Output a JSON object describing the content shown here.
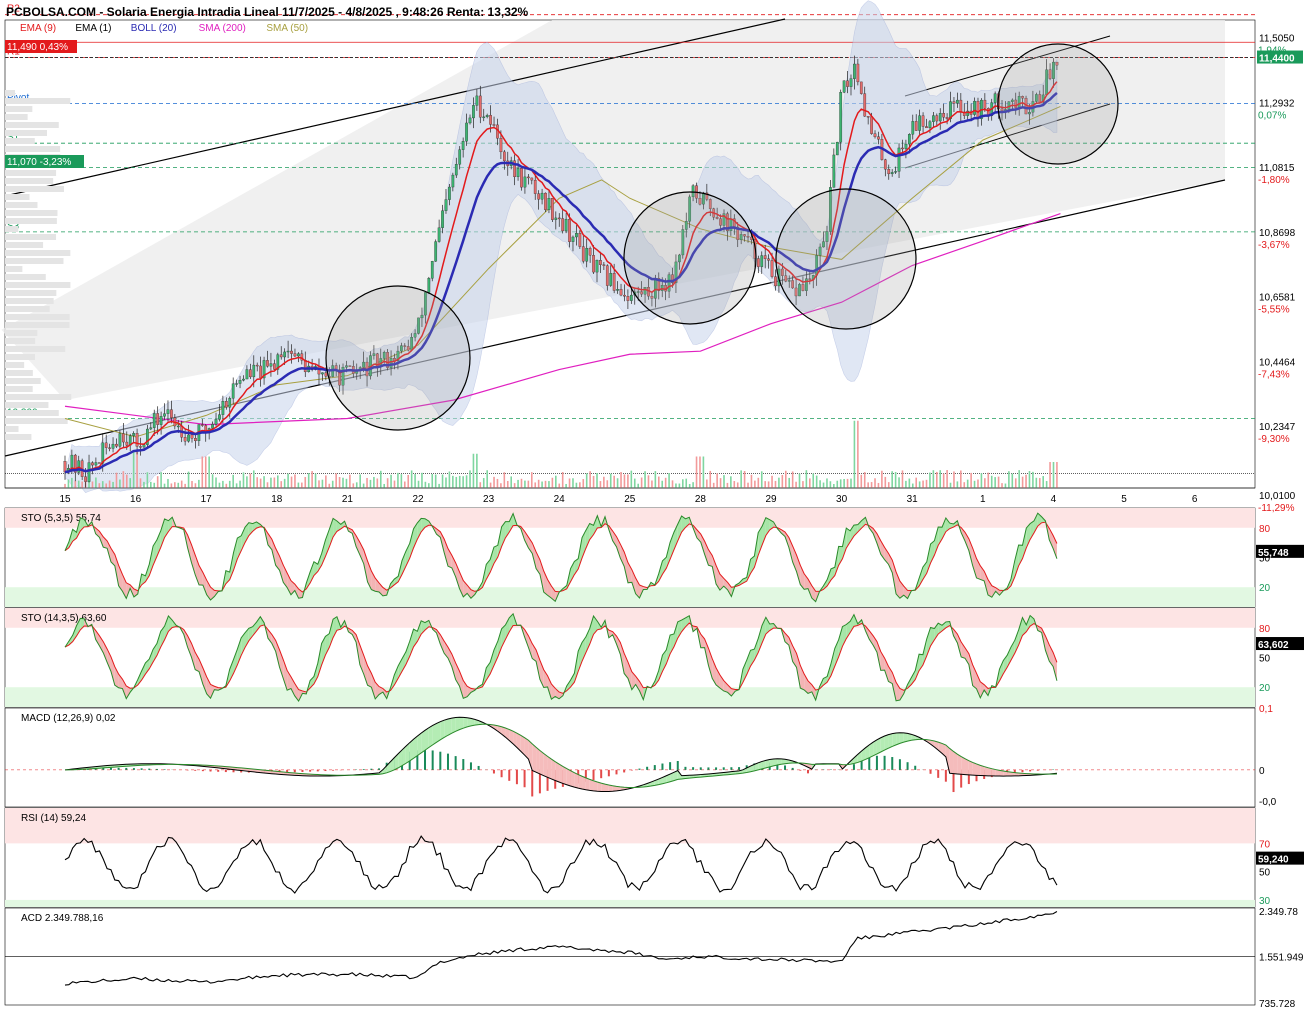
{
  "header": {
    "title": "PCBOLSA.COM - Solaria Energia Intradia Lineal 11/7/2025 - 4/8/2025 , 9:48:26 Renta: 13,32%"
  },
  "legend": [
    {
      "label": "EMA (9)",
      "color": "#e31a1c"
    },
    {
      "label": "EMA (1)",
      "color": "#000000"
    },
    {
      "label": "BOLL (20)",
      "color": "#2b2bb3"
    },
    {
      "label": "SMA (200)",
      "color": "#e020c0"
    },
    {
      "label": "SMA (50)",
      "color": "#a8a040"
    }
  ],
  "price_tags": [
    {
      "text": "11,490  0,43%",
      "color": "#e31a1c"
    },
    {
      "text": "11,070  -3,23%",
      "color": "#1a9a5a"
    },
    {
      "text": "11,4400",
      "color": "#1a9a5a"
    }
  ],
  "pivot_labels": [
    "R2",
    "R1",
    "Pivot",
    "S1",
    "S2",
    "S3",
    "10.300"
  ],
  "chart_data": [
    {
      "type": "line",
      "name": "main",
      "xlabels": [
        "15",
        "16",
        "17",
        "18",
        "21",
        "22",
        "23",
        "24",
        "25",
        "28",
        "29",
        "30",
        "31",
        "1",
        "4",
        "5",
        "6"
      ],
      "yticks": [
        "11,5050",
        "11,2932",
        "11,0815",
        "10,8698",
        "10,6581",
        "10,4464",
        "10,2347",
        "10,0100"
      ],
      "pct_ticks": [
        "1,94%",
        "0,07%",
        "-1,80%",
        "-3,67%",
        "-5,55%",
        "-7,43%",
        "-9,30%",
        "-11,29%"
      ],
      "ylim": [
        10.0,
        11.53
      ],
      "last_price": 11.44,
      "close_anchors": [
        [
          0,
          10.12
        ],
        [
          0.3,
          10.08
        ],
        [
          0.8,
          10.22
        ],
        [
          1.0,
          10.17
        ],
        [
          1.4,
          10.28
        ],
        [
          1.8,
          10.2
        ],
        [
          2.0,
          10.22
        ],
        [
          2.5,
          10.4
        ],
        [
          2.9,
          10.42
        ],
        [
          3.1,
          10.5
        ],
        [
          3.5,
          10.41
        ],
        [
          4.0,
          10.4
        ],
        [
          4.3,
          10.43
        ],
        [
          4.8,
          10.48
        ],
        [
          5.0,
          10.55
        ],
        [
          5.2,
          10.78
        ],
        [
          5.5,
          11.05
        ],
        [
          5.8,
          11.3
        ],
        [
          6.0,
          11.25
        ],
        [
          6.3,
          11.08
        ],
        [
          6.6,
          11.02
        ],
        [
          7.0,
          10.92
        ],
        [
          7.5,
          10.75
        ],
        [
          8.0,
          10.66
        ],
        [
          8.3,
          10.68
        ],
        [
          8.6,
          10.72
        ],
        [
          8.9,
          11.0
        ],
        [
          9.2,
          10.94
        ],
        [
          9.6,
          10.85
        ],
        [
          10.0,
          10.74
        ],
        [
          10.3,
          10.67
        ],
        [
          10.6,
          10.72
        ],
        [
          10.8,
          10.9
        ],
        [
          11.0,
          11.32
        ],
        [
          11.2,
          11.42
        ],
        [
          11.4,
          11.2
        ],
        [
          11.7,
          11.06
        ],
        [
          12.0,
          11.22
        ],
        [
          12.3,
          11.25
        ],
        [
          12.6,
          11.28
        ],
        [
          13.0,
          11.27
        ],
        [
          13.3,
          11.3
        ],
        [
          13.6,
          11.28
        ],
        [
          13.8,
          11.32
        ],
        [
          14.05,
          11.44
        ]
      ],
      "volume_spikes": [
        [
          11.2,
          0.95
        ],
        [
          5.8,
          0.35
        ],
        [
          1.0,
          0.4
        ],
        [
          14.0,
          0.2
        ],
        [
          2.0,
          0.3
        ],
        [
          9.0,
          0.3
        ]
      ],
      "sma200": [
        [
          0,
          10.3
        ],
        [
          2,
          10.24
        ],
        [
          4,
          10.26
        ],
        [
          5.5,
          10.32
        ],
        [
          7,
          10.42
        ],
        [
          8,
          10.47
        ],
        [
          9,
          10.48
        ],
        [
          10,
          10.57
        ],
        [
          11,
          10.64
        ],
        [
          12,
          10.76
        ],
        [
          13,
          10.84
        ],
        [
          14.1,
          10.93
        ]
      ],
      "sma50": [
        [
          0,
          10.26
        ],
        [
          1,
          10.2
        ],
        [
          2,
          10.27
        ],
        [
          3,
          10.37
        ],
        [
          4,
          10.4
        ],
        [
          5,
          10.5
        ],
        [
          6,
          10.75
        ],
        [
          7,
          10.98
        ],
        [
          7.6,
          11.04
        ],
        [
          8,
          10.98
        ],
        [
          9,
          10.88
        ],
        [
          10,
          10.82
        ],
        [
          11,
          10.78
        ],
        [
          12,
          10.98
        ],
        [
          13,
          11.17
        ],
        [
          14.1,
          11.28
        ]
      ],
      "pivots": [
        {
          "name": "R2",
          "value": 11.58,
          "color": "#e31a1c"
        },
        {
          "name": "R1",
          "value": 11.44,
          "color": "#e31a1c"
        },
        {
          "name": "Pivot",
          "value": 11.29,
          "color": "#1a6ad0"
        },
        {
          "name": "S1",
          "value": 11.16,
          "color": "#1a9a5a"
        },
        {
          "name": "S2",
          "value": 11.08,
          "color": "#1a9a5a"
        },
        {
          "name": "S3",
          "value": 10.87,
          "color": "#1a9a5a"
        },
        {
          "name": "10.300",
          "value": 10.26,
          "color": "#1a9a5a"
        }
      ]
    },
    {
      "type": "line",
      "name": "STO (5,3,5)",
      "title": "STO (5,3,5)   55,74",
      "value_label": "55,748",
      "yticks": [
        "80",
        "50",
        "20"
      ],
      "ylim": [
        0,
        100
      ],
      "zones": [
        80,
        20
      ]
    },
    {
      "type": "line",
      "name": "STO (14,3,5)",
      "title": "STO (14,3,5)   63,60",
      "value_label": "63,602",
      "yticks": [
        "80",
        "50",
        "20"
      ],
      "ylim": [
        0,
        100
      ],
      "zones": [
        80,
        20
      ]
    },
    {
      "type": "line",
      "name": "MACD (12,26,9)",
      "title": "MACD (12,26,9)   0,02",
      "yticks": [
        "0,1",
        "0",
        "-0,0"
      ],
      "ylim": [
        -0.06,
        0.1
      ]
    },
    {
      "type": "line",
      "name": "RSI (14)",
      "title": "RSI (14)   59,24",
      "value_label": "59,240",
      "yticks": [
        "70",
        "50",
        "30"
      ],
      "ylim": [
        25,
        95
      ],
      "zones": [
        70,
        30
      ]
    },
    {
      "type": "line",
      "name": "ACD",
      "title": "ACD   2.349.788,16",
      "yticks": [
        "2.349.78",
        "1.551.949",
        "735.728"
      ],
      "ylim": [
        700000,
        2400000
      ],
      "acd_anchors": [
        [
          0,
          1.08
        ],
        [
          1,
          1.16
        ],
        [
          2,
          1.1
        ],
        [
          3,
          1.22
        ],
        [
          4,
          1.24
        ],
        [
          5,
          1.18
        ],
        [
          5.3,
          1.45
        ],
        [
          5.8,
          1.58
        ],
        [
          6.2,
          1.64
        ],
        [
          6.5,
          1.68
        ],
        [
          7,
          1.72
        ],
        [
          8,
          1.62
        ],
        [
          8.5,
          1.5
        ],
        [
          9,
          1.55
        ],
        [
          10,
          1.5
        ],
        [
          11,
          1.46
        ],
        [
          11.2,
          1.86
        ],
        [
          12,
          1.98
        ],
        [
          13,
          2.12
        ],
        [
          14.05,
          2.32
        ]
      ]
    }
  ]
}
